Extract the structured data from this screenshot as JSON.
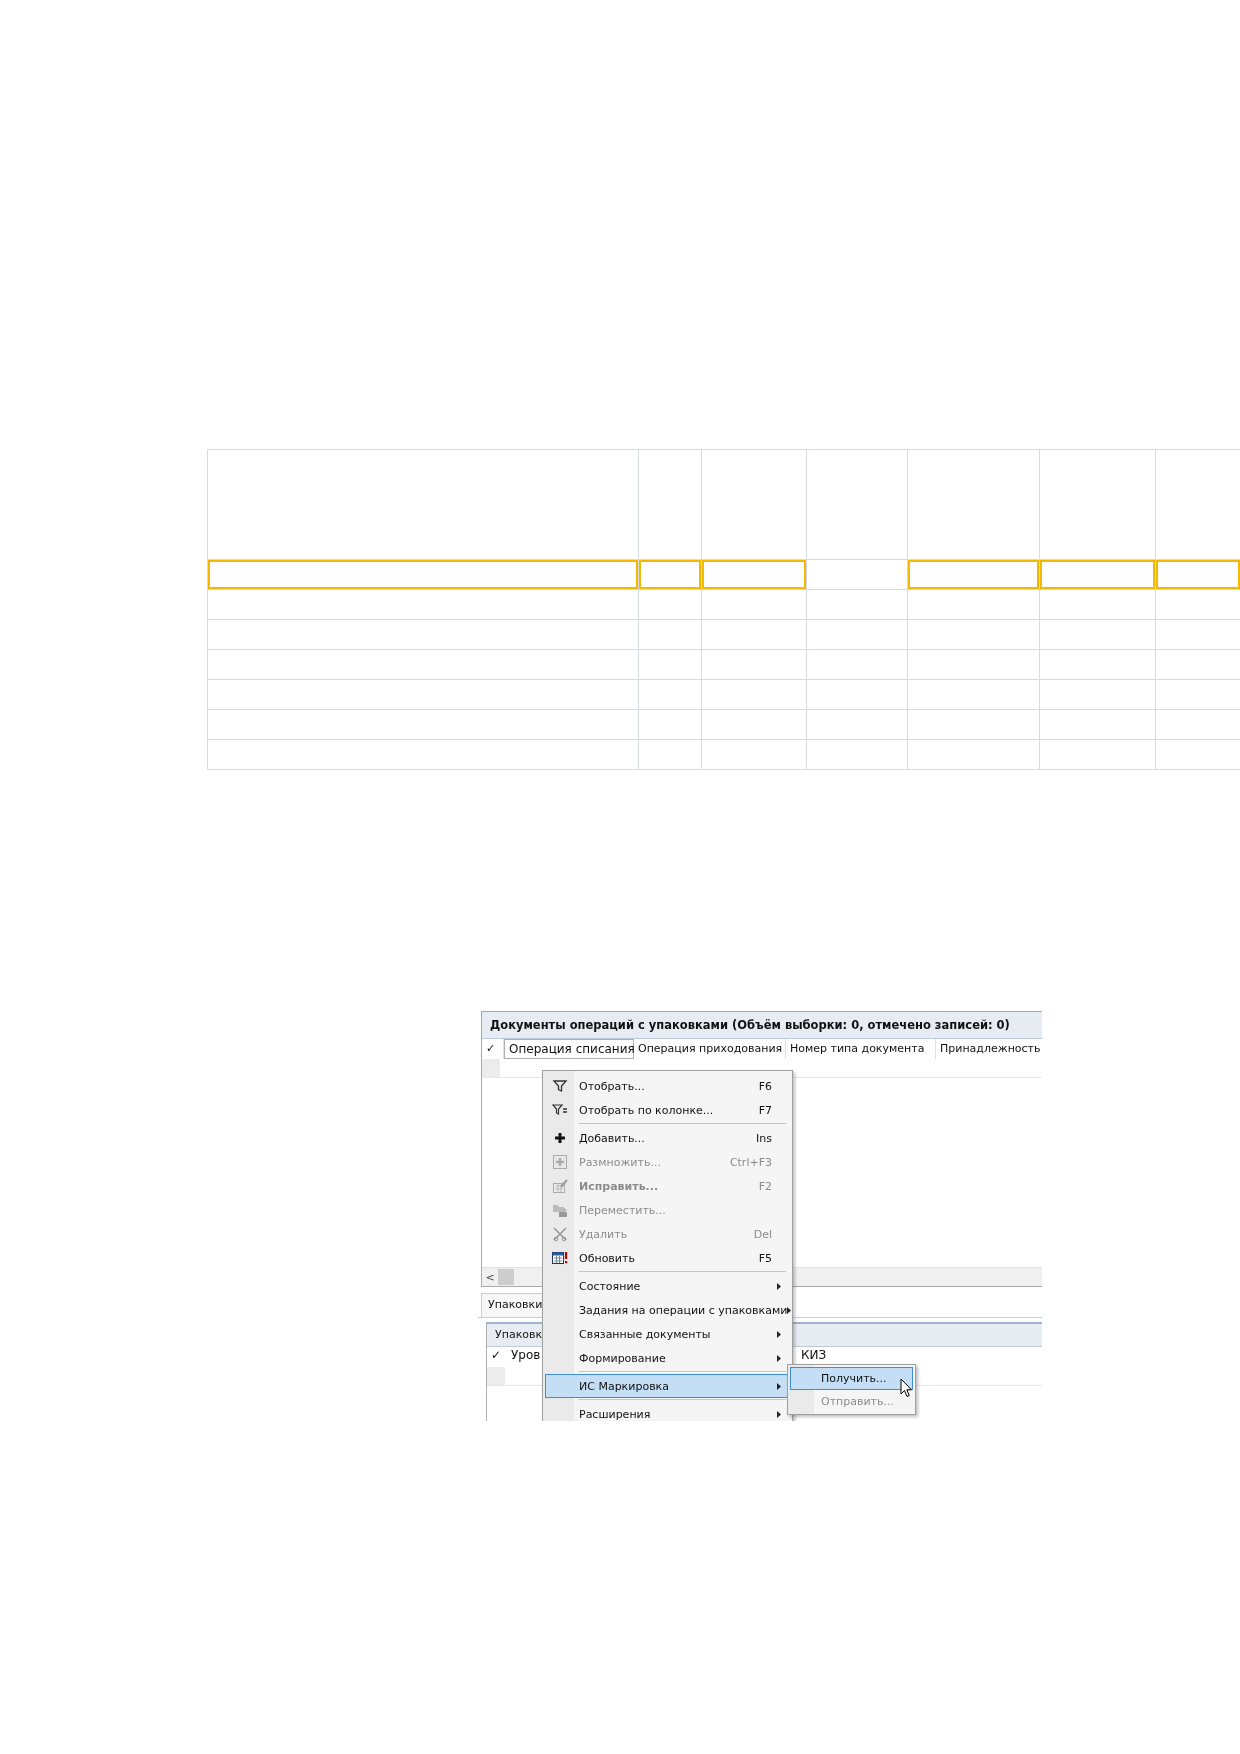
{
  "table": {
    "rows": [
      {
        "kind": "header",
        "cells": [
          {
            "highlighted": false
          },
          {
            "highlighted": false
          },
          {
            "highlighted": false
          },
          {
            "highlighted": false
          },
          {
            "highlighted": false
          },
          {
            "highlighted": false
          },
          {
            "highlighted": false
          }
        ]
      },
      {
        "kind": "body",
        "cells": [
          {
            "highlighted": true
          },
          {
            "highlighted": true
          },
          {
            "highlighted": true
          },
          {
            "highlighted": false
          },
          {
            "highlighted": true
          },
          {
            "highlighted": true
          },
          {
            "highlighted": true
          }
        ]
      },
      {
        "kind": "body",
        "cells": [
          {
            "highlighted": false
          },
          {
            "highlighted": false
          },
          {
            "highlighted": false
          },
          {
            "highlighted": false
          },
          {
            "highlighted": false
          },
          {
            "highlighted": false
          },
          {
            "highlighted": false
          }
        ]
      },
      {
        "kind": "body",
        "cells": [
          {
            "highlighted": false
          },
          {
            "highlighted": false
          },
          {
            "highlighted": false
          },
          {
            "highlighted": false
          },
          {
            "highlighted": false
          },
          {
            "highlighted": false
          },
          {
            "highlighted": false
          }
        ]
      },
      {
        "kind": "body",
        "cells": [
          {
            "highlighted": false
          },
          {
            "highlighted": false
          },
          {
            "highlighted": false
          },
          {
            "highlighted": false
          },
          {
            "highlighted": false
          },
          {
            "highlighted": false
          },
          {
            "highlighted": false
          }
        ]
      },
      {
        "kind": "body",
        "cells": [
          {
            "highlighted": false
          },
          {
            "highlighted": false
          },
          {
            "highlighted": false
          },
          {
            "highlighted": false
          },
          {
            "highlighted": false
          },
          {
            "highlighted": false
          },
          {
            "highlighted": false
          }
        ]
      },
      {
        "kind": "body",
        "cells": [
          {
            "highlighted": false
          },
          {
            "highlighted": false
          },
          {
            "highlighted": false
          },
          {
            "highlighted": false
          },
          {
            "highlighted": false
          },
          {
            "highlighted": false
          },
          {
            "highlighted": false
          }
        ]
      },
      {
        "kind": "body",
        "cells": [
          {
            "highlighted": false
          },
          {
            "highlighted": false
          },
          {
            "highlighted": false
          },
          {
            "highlighted": false
          },
          {
            "highlighted": false
          },
          {
            "highlighted": false
          },
          {
            "highlighted": false
          }
        ]
      }
    ]
  },
  "screenshot": {
    "window": {
      "title": "Документы операций с упаковками (Объём выборки: 0, отмечено записей: 0)",
      "columns": [
        {
          "label": "✓",
          "selected": false
        },
        {
          "label": "Операция списания",
          "selected": true
        },
        {
          "label": "Операция приходования",
          "selected": false
        },
        {
          "label": "Номер типа документа",
          "selected": false
        },
        {
          "label": "Принадлежность",
          "selected": false
        }
      ],
      "scroll_arrow": "<"
    },
    "bottom_panel": {
      "tab": "Упаковки",
      "header": "Упаковк",
      "columns": [
        {
          "label": "✓"
        },
        {
          "label": "Уров"
        },
        {
          "label": "КИЗ"
        }
      ]
    },
    "context_menu": {
      "items": [
        {
          "kind": "item",
          "label": "Отобрать...",
          "shortcut": "F6",
          "disabled": false,
          "bold": false,
          "selected": false
        },
        {
          "kind": "item",
          "label": "Отобрать по колонке...",
          "shortcut": "F7",
          "disabled": false,
          "bold": false,
          "selected": false
        },
        {
          "kind": "separator"
        },
        {
          "kind": "item",
          "label": "Добавить...",
          "shortcut": "Ins",
          "disabled": false,
          "bold": false,
          "selected": false
        },
        {
          "kind": "item",
          "label": "Размножить...",
          "shortcut": "Ctrl+F3",
          "disabled": true,
          "bold": false,
          "selected": false
        },
        {
          "kind": "item",
          "label": "Исправить...",
          "shortcut": "F2",
          "disabled": true,
          "bold": true,
          "selected": false
        },
        {
          "kind": "item",
          "label": "Переместить...",
          "disabled": true,
          "bold": false,
          "selected": false
        },
        {
          "kind": "item",
          "label": "Удалить",
          "shortcut": "Del",
          "disabled": true,
          "bold": false,
          "selected": false
        },
        {
          "kind": "item",
          "label": "Обновить",
          "shortcut": "F5",
          "disabled": false,
          "bold": false,
          "selected": false
        },
        {
          "kind": "separator"
        },
        {
          "kind": "submenu",
          "label": "Состояние",
          "disabled": false,
          "bold": false,
          "selected": false
        },
        {
          "kind": "submenu",
          "label": "Задания на операции с упаковками",
          "disabled": false,
          "bold": false,
          "selected": false
        },
        {
          "kind": "submenu",
          "label": "Связанные документы",
          "disabled": false,
          "bold": false,
          "selected": false
        },
        {
          "kind": "submenu",
          "label": "Формирование",
          "disabled": false,
          "bold": false,
          "selected": false
        },
        {
          "kind": "separator"
        },
        {
          "kind": "submenu",
          "label": "ИС Маркировка",
          "disabled": false,
          "bold": false,
          "selected": true
        },
        {
          "kind": "separator"
        },
        {
          "kind": "submenu",
          "label": "Расширения",
          "disabled": false,
          "bold": false,
          "selected": false
        }
      ]
    },
    "submenu": {
      "items": [
        {
          "label": "Получить...",
          "disabled": false,
          "selected": true
        },
        {
          "label": "Отправить...",
          "disabled": true,
          "selected": false
        }
      ]
    }
  }
}
